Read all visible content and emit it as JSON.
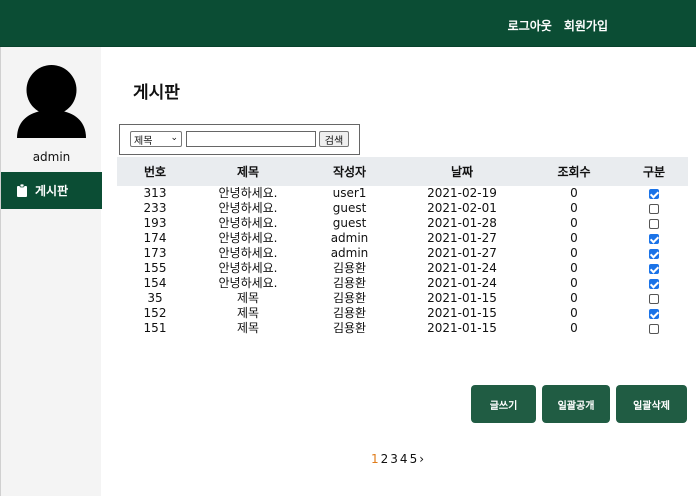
{
  "header": {
    "nav": {
      "logout": "로그아웃",
      "signup": "회원가입"
    },
    "bg_color": "#0b4d34"
  },
  "sidebar": {
    "username": "admin",
    "menu_item": {
      "label": "게시판",
      "icon": "clipboard-icon"
    }
  },
  "main": {
    "title": "게시판",
    "search": {
      "selected_option": "제목",
      "input_value": "",
      "button_label": "검색"
    },
    "table": {
      "headers": {
        "num": "번호",
        "title": "제목",
        "author": "작성자",
        "date": "날짜",
        "views": "조회수",
        "type": "구분"
      },
      "rows": [
        {
          "num": "313",
          "title": "안녕하세요.",
          "author": "user1",
          "date": "2021-02-19",
          "views": "0",
          "checked": true
        },
        {
          "num": "233",
          "title": "안녕하세요.",
          "author": "guest",
          "date": "2021-02-01",
          "views": "0",
          "checked": false
        },
        {
          "num": "193",
          "title": "안녕하세요.",
          "author": "guest",
          "date": "2021-01-28",
          "views": "0",
          "checked": false
        },
        {
          "num": "174",
          "title": "안녕하세요.",
          "author": "admin",
          "date": "2021-01-27",
          "views": "0",
          "checked": true
        },
        {
          "num": "173",
          "title": "안녕하세요.",
          "author": "admin",
          "date": "2021-01-27",
          "views": "0",
          "checked": true
        },
        {
          "num": "155",
          "title": "안녕하세요.",
          "author": "김용환",
          "date": "2021-01-24",
          "views": "0",
          "checked": true
        },
        {
          "num": "154",
          "title": "안녕하세요.",
          "author": "김용환",
          "date": "2021-01-24",
          "views": "0",
          "checked": true
        },
        {
          "num": "35",
          "title": "제목",
          "author": "김용환",
          "date": "2021-01-15",
          "views": "0",
          "checked": false
        },
        {
          "num": "152",
          "title": "제목",
          "author": "김용환",
          "date": "2021-01-15",
          "views": "0",
          "checked": true
        },
        {
          "num": "151",
          "title": "제목",
          "author": "김용환",
          "date": "2021-01-15",
          "views": "0",
          "checked": false
        }
      ]
    },
    "buttons": {
      "write": "글쓰기",
      "publish_all": "일괄공개",
      "delete_all": "일괄삭제"
    },
    "pagination": {
      "pages": [
        "1",
        "2",
        "3",
        "4",
        "5"
      ],
      "current": "1",
      "next": "›"
    }
  }
}
